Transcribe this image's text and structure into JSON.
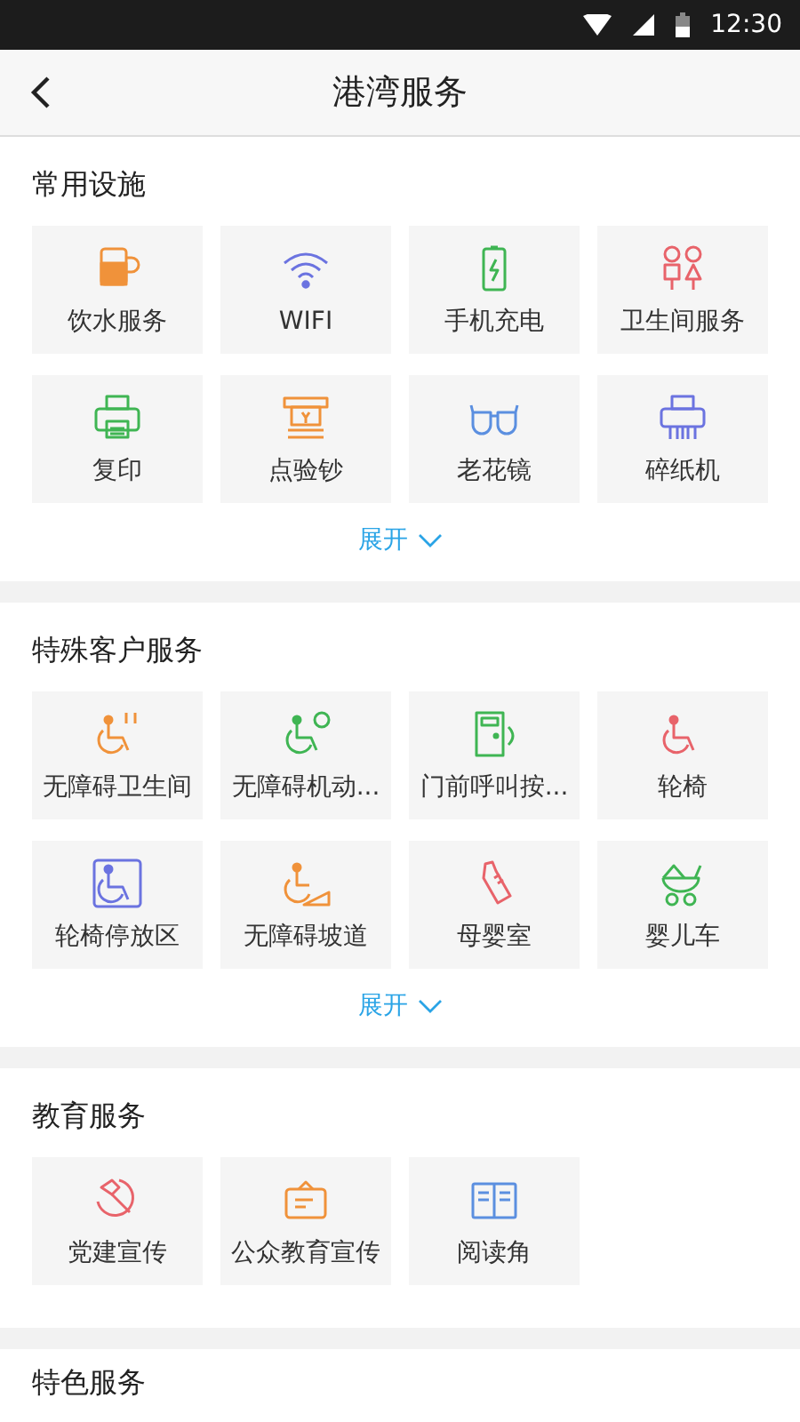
{
  "status_bar": {
    "time": "12:30"
  },
  "header": {
    "title": "港湾服务"
  },
  "sections": [
    {
      "title": "常用设施",
      "expand": "展开",
      "items": [
        {
          "label": "饮水服务",
          "color": "#f0923a"
        },
        {
          "label": "WIFI",
          "color": "#6b73e0"
        },
        {
          "label": "手机充电",
          "color": "#3fb553"
        },
        {
          "label": "卫生间服务",
          "color": "#e8636a"
        },
        {
          "label": "复印",
          "color": "#3fb553"
        },
        {
          "label": "点验钞",
          "color": "#f0923a"
        },
        {
          "label": "老花镜",
          "color": "#5b8fe0"
        },
        {
          "label": "碎纸机",
          "color": "#6b73e0"
        }
      ]
    },
    {
      "title": "特殊客户服务",
      "expand": "展开",
      "items": [
        {
          "label": "无障碍卫生间",
          "color": "#f0923a"
        },
        {
          "label": "无障碍机动...",
          "color": "#3fb553"
        },
        {
          "label": "门前呼叫按...",
          "color": "#3fb553"
        },
        {
          "label": "轮椅",
          "color": "#e8636a"
        },
        {
          "label": "轮椅停放区",
          "color": "#6b73e0"
        },
        {
          "label": "无障碍坡道",
          "color": "#f0923a"
        },
        {
          "label": "母婴室",
          "color": "#e8636a"
        },
        {
          "label": "婴儿车",
          "color": "#3fb553"
        }
      ]
    },
    {
      "title": "教育服务",
      "items": [
        {
          "label": "党建宣传",
          "color": "#e8636a"
        },
        {
          "label": "公众教育宣传",
          "color": "#f0923a"
        },
        {
          "label": "阅读角",
          "color": "#5b8fe0"
        }
      ]
    },
    {
      "title": "特色服务"
    }
  ]
}
